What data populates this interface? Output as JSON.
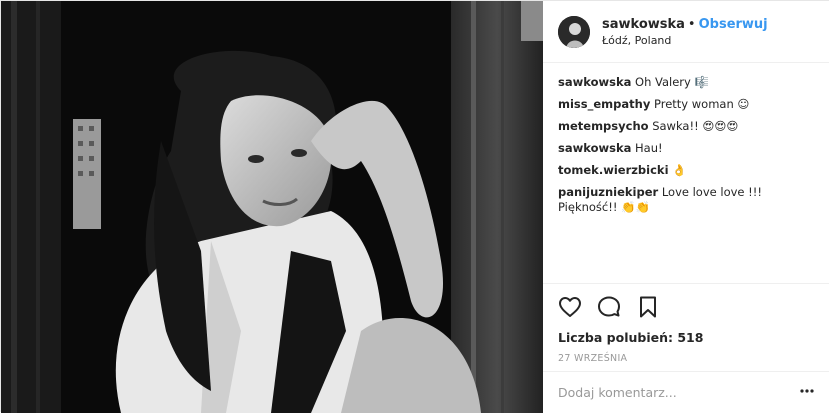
{
  "post": {
    "username": "sawkowska",
    "separator": "•",
    "follow_label": "Obserwuj",
    "location": "Łódź, Poland"
  },
  "comments": [
    {
      "user": "sawkowska",
      "text": "Oh Valery 🎼"
    },
    {
      "user": "miss_empathy",
      "text": "Pretty woman ☺"
    },
    {
      "user": "metempsycho",
      "text": "Sawka!! 😍😍😍"
    },
    {
      "user": "sawkowska",
      "text": "Hau!"
    },
    {
      "user": "tomek.wierzbicki",
      "text": "👌"
    },
    {
      "user": "panijuzniekiper",
      "text": "Love love love !!! Piękność!! 👏👏"
    }
  ],
  "actions": {
    "like_icon": "heart-icon",
    "comment_icon": "comment-bubble-icon",
    "save_icon": "bookmark-icon"
  },
  "likes": {
    "label": "Liczba polubień:",
    "count": "518"
  },
  "date": "27 WRZEŚNIA",
  "add_comment": {
    "placeholder": "Dodaj komentarz..."
  },
  "colors": {
    "accent": "#3897f0",
    "text": "#262626",
    "muted": "#999999",
    "border": "#efefef"
  }
}
